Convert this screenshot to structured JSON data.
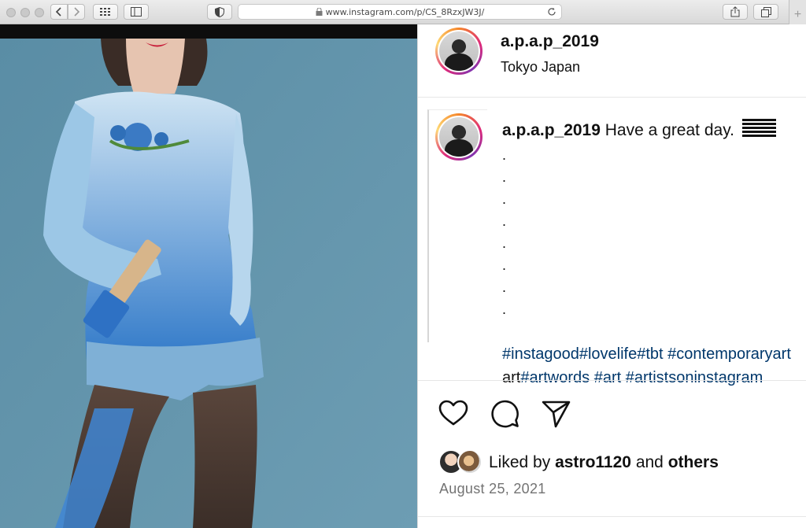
{
  "browser": {
    "url": "www.instagram.com/p/CS_8RzxJW3J/",
    "new_tab_label": "+",
    "icons": [
      "back-icon",
      "forward-icon",
      "grid-icon",
      "sidebar-icon",
      "shield-icon",
      "lock-icon",
      "reload-icon",
      "share-icon",
      "tabs-icon"
    ]
  },
  "post": {
    "header": {
      "username": "a.p.a.p_2019",
      "location": "Tokyo Japan"
    },
    "caption": {
      "username": "a.p.a.p_2019",
      "text": "Have a great day.",
      "dots": [
        ".",
        ".",
        ".",
        ".",
        ".",
        ".",
        ".",
        "."
      ],
      "hashtags_line1": "#instagood#lovelife#tbt #contemporaryart",
      "hashtags_line2_plain": "art",
      "hashtags_line2": "#artwords #art #artistsoninstagram"
    },
    "actions": {
      "icons": [
        "heart-icon",
        "comment-icon",
        "share-icon"
      ]
    },
    "likes": {
      "prefix": "Liked by",
      "user": "astro1120",
      "middle": "and",
      "suffix": "others"
    },
    "date": "August 25, 2021"
  },
  "colors": {
    "link": "#00376b",
    "text": "#111111",
    "muted": "#737373",
    "photo_background": "#5c8fa6"
  }
}
